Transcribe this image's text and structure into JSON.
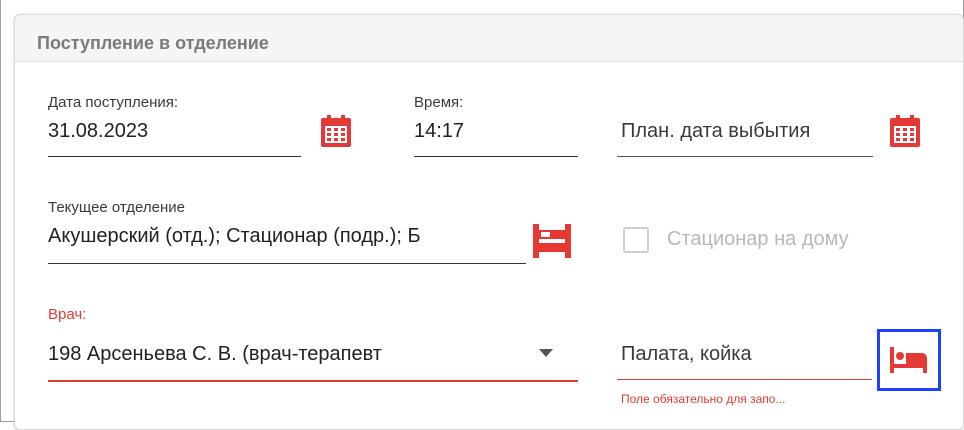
{
  "card": {
    "title": "Поступление в отделение"
  },
  "admission_date": {
    "label": "Дата поступления:",
    "value": "31.08.2023",
    "icon": "calendar-icon"
  },
  "time": {
    "label": "Время:",
    "value": "14:17"
  },
  "planned_discharge": {
    "placeholder": "План. дата выбытия",
    "icon": "calendar-icon"
  },
  "current_department": {
    "label": "Текущее отделение",
    "value": "Акушерский (отд.); Стационар (подр.); Б",
    "icon": "bed-icon"
  },
  "home_hospital": {
    "label": "Стационар на дому",
    "checked": false
  },
  "doctor": {
    "label": "Врач:",
    "value": "198 Арсеньева С. В.  (врач-терапевт",
    "icon": "chevron-down-icon"
  },
  "ward_bed": {
    "placeholder": "Палата, койка",
    "error": "Поле обязательно для запо...",
    "icon": "bed-icon"
  },
  "colors": {
    "accent": "#e53935",
    "focus": "#1e40ff",
    "header_bg": "#f5f5f5"
  }
}
